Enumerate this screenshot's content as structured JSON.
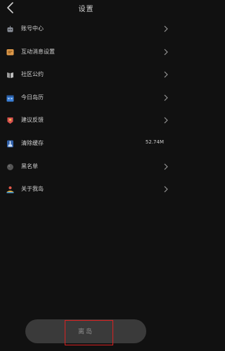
{
  "header": {
    "title": "设置",
    "back_icon": "chevron-left-icon"
  },
  "settings": {
    "items": [
      {
        "label": "账号中心",
        "icon": "robot-icon",
        "icon_color": "#8a8f99",
        "value": ""
      },
      {
        "label": "互动消息设置",
        "icon": "message-icon",
        "icon_color": "#e09a4a",
        "value": ""
      },
      {
        "label": "社区公约",
        "icon": "book-icon",
        "icon_color": "#9c9c9c",
        "value": ""
      },
      {
        "label": "今日岛历",
        "icon": "calendar-icon",
        "icon_color": "#3b7fd6",
        "value": ""
      },
      {
        "label": "建议反馈",
        "icon": "feedback-icon",
        "icon_color": "#d9534f",
        "value": ""
      },
      {
        "label": "清除缓存",
        "icon": "broom-icon",
        "icon_color": "#4f8fdc",
        "value": "52.74M"
      },
      {
        "label": "黑名单",
        "icon": "ball-icon",
        "icon_color": "#555555",
        "value": ""
      },
      {
        "label": "关于我岛",
        "icon": "island-icon",
        "icon_color": "#e0b24a",
        "value": ""
      }
    ]
  },
  "footer": {
    "logout_label": "离岛"
  },
  "colors": {
    "background": "#111111",
    "text": "#d0d0d0",
    "button_bg": "#3a3a3a",
    "highlight": "#d82222"
  }
}
